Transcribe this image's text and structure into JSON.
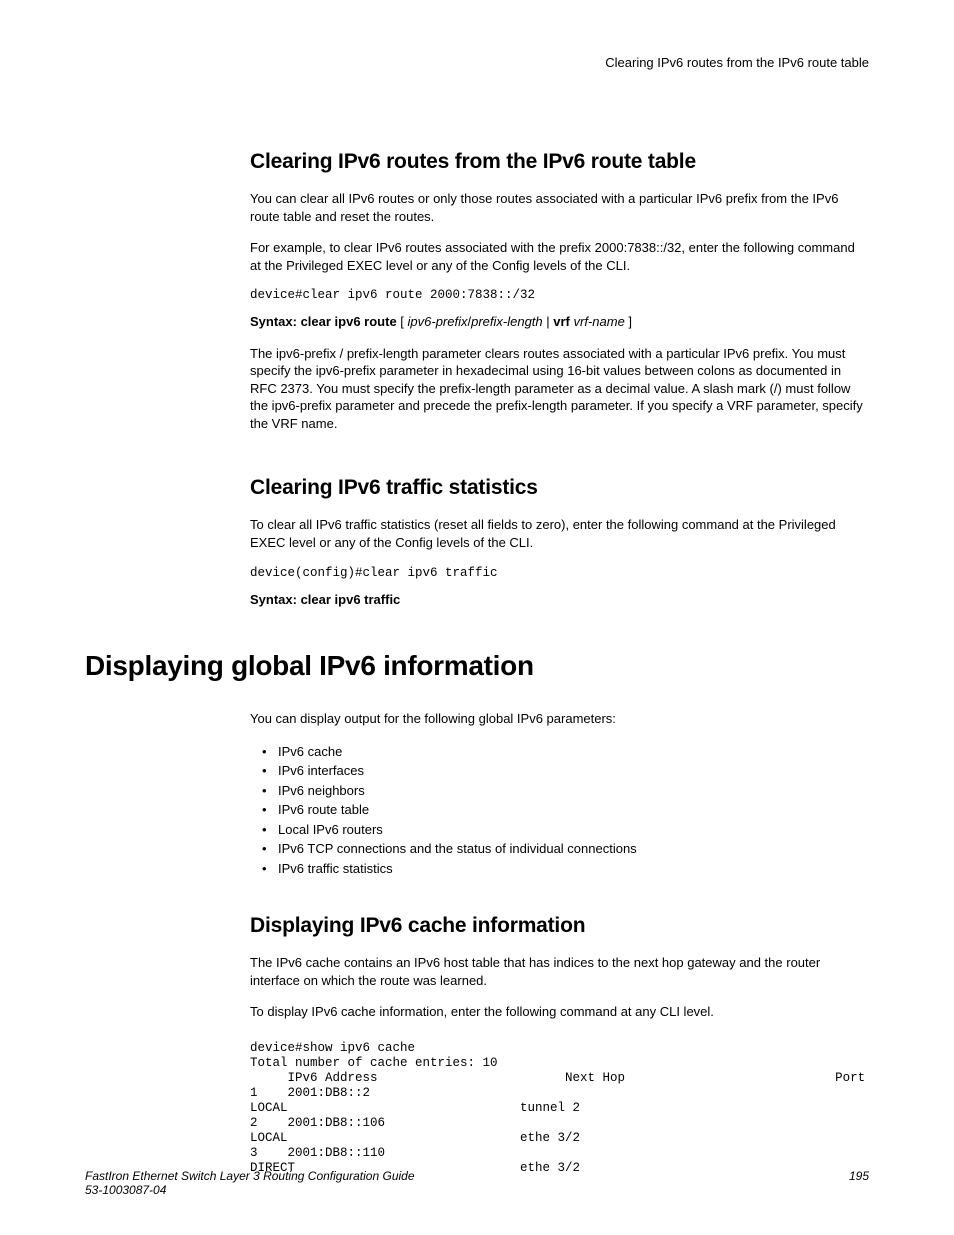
{
  "running_head": "Clearing IPv6 routes from the IPv6 route table",
  "section1": {
    "heading": "Clearing IPv6 routes from the IPv6 route table",
    "p1": "You can clear all IPv6 routes or only those routes associated with a particular IPv6 prefix from the IPv6 route table and reset the routes.",
    "p2": "For example, to clear IPv6 routes associated with the prefix 2000:7838::/32, enter the following command at the Privileged EXEC level or any of the Config levels of the CLI.",
    "code": "device#clear ipv6 route 2000:7838::/32",
    "syntax_label": "Syntax: clear ipv6 route",
    "syntax_arg1": "ipv6-prefix",
    "syntax_sep1": "/",
    "syntax_arg2": "prefix-length",
    "syntax_sep2": " | ",
    "syntax_bold2": "vrf",
    "syntax_arg3": "vrf-name",
    "p3": "The ipv6-prefix / prefix-length parameter clears routes associated with a particular IPv6 prefix. You must specify the ipv6-prefix parameter in hexadecimal using 16-bit values between colons as documented in RFC 2373. You must specify the prefix-length parameter as a decimal value. A slash mark (/) must follow the ipv6-prefix parameter and precede the prefix-length parameter. If you specify a VRF parameter, specify the VRF name."
  },
  "section2": {
    "heading": "Clearing IPv6 traffic statistics",
    "p1": "To clear all IPv6 traffic statistics (reset all fields to zero), enter the following command at the Privileged EXEC level or any of the Config levels of the CLI.",
    "code": "device(config)#clear ipv6 traffic",
    "syntax": "Syntax: clear ipv6 traffic"
  },
  "section3": {
    "heading": "Displaying global IPv6 information",
    "p1": "You can display output for the following global IPv6 parameters:",
    "bullets": [
      "IPv6 cache",
      "IPv6 interfaces",
      "IPv6 neighbors",
      "IPv6 route table",
      "Local IPv6 routers",
      "IPv6 TCP connections and the status of individual connections",
      "IPv6 traffic statistics"
    ]
  },
  "section4": {
    "heading": "Displaying IPv6 cache information",
    "p1": "The IPv6 cache contains an IPv6 host table that has indices to the next hop gateway and the router interface on which the route was learned.",
    "p2": "To display IPv6 cache information, enter the following command at any CLI level.",
    "code": "device#show ipv6 cache\nTotal number of cache entries: 10\n     IPv6 Address                         Next Hop                            Port\n1    2001:DB8::2                          \nLOCAL                               tunnel 2\n2    2001:DB8::106                        \nLOCAL                               ethe 3/2\n3    2001:DB8::110                        \nDIRECT                              ethe 3/2"
  },
  "footer": {
    "title": "FastIron Ethernet Switch Layer 3 Routing Configuration Guide",
    "page": "195",
    "docnum": "53-1003087-04"
  }
}
